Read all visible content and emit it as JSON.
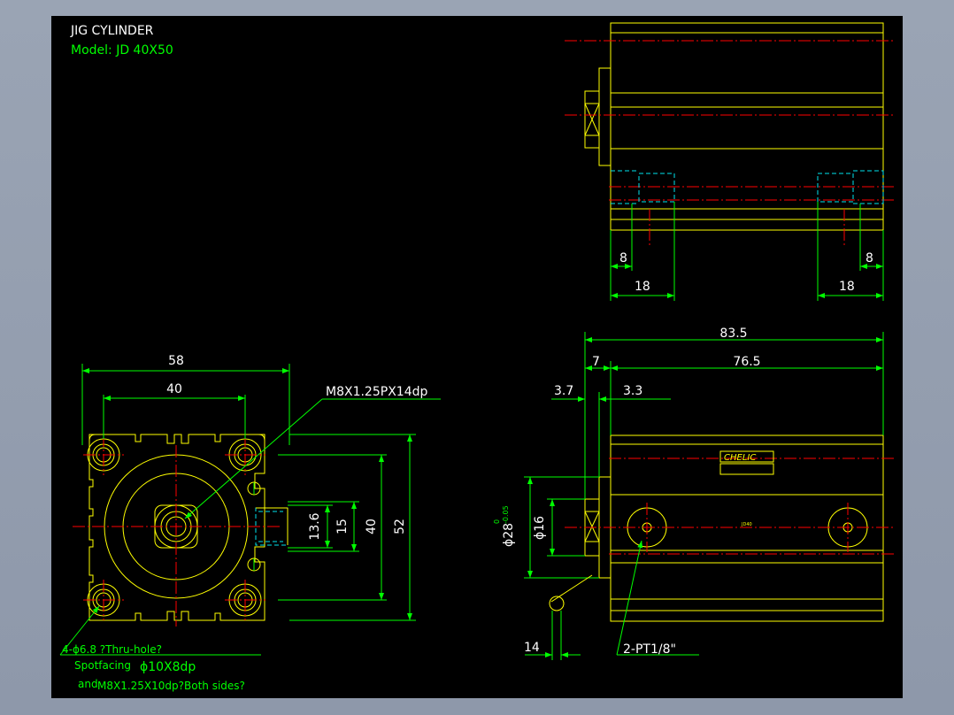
{
  "title": {
    "name": "JIG CYLINDER",
    "model": "Model: JD 40X50"
  },
  "front_view": {
    "dims": {
      "width_outer": "58",
      "width_inner": "40",
      "h_13_6": "13.6",
      "h_15": "15",
      "h_40": "40",
      "h_52": "52"
    },
    "thread_callout": "M8X1.25PX14dp",
    "hole_note": {
      "line1": "4-ϕ6.8 ?Thru-hole?",
      "line2_prefix": "Spotfacing",
      "line2_value": "ϕ10X8dp",
      "line3_prefix": "and",
      "line3_value": "M8X1.25X10dp?Both sides?"
    }
  },
  "top_view": {
    "dims": {
      "left_8": "8",
      "left_18": "18",
      "right_8": "8",
      "right_18": "18"
    }
  },
  "side_view": {
    "dims": {
      "overall": "83.5",
      "d7": "7",
      "d76_5": "76.5",
      "d3_7": "3.7",
      "d3_3": "3.3",
      "d14": "14",
      "dia28": "ϕ28",
      "dia28_upper": "0",
      "dia28_lower": "-0.05",
      "dia16": "ϕ16"
    },
    "port_callout": "2-PT1/8\"",
    "label_brand": "CHELIC",
    "label_code": "JD40"
  },
  "colors": {
    "outline": "#ffff00",
    "dimension": "#00ff00",
    "centerline": "#ff0000",
    "hidden": "#00e5ee",
    "background": "#000000"
  }
}
